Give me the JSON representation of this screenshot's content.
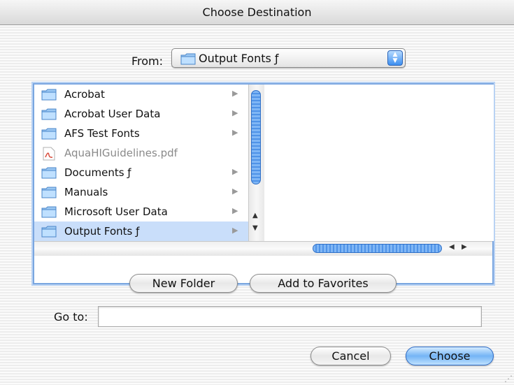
{
  "window": {
    "title": "Choose Destination"
  },
  "from": {
    "label": "From:",
    "selected": "Output Fonts ƒ"
  },
  "browser": {
    "items": [
      {
        "label": "Acrobat",
        "type": "folder"
      },
      {
        "label": "Acrobat User Data",
        "type": "folder"
      },
      {
        "label": "AFS Test Fonts",
        "type": "folder"
      },
      {
        "label": "AquaHIGuidelines.pdf",
        "type": "pdf"
      },
      {
        "label": "Documents ƒ",
        "type": "folder"
      },
      {
        "label": "Manuals",
        "type": "folder"
      },
      {
        "label": "Microsoft User Data",
        "type": "folder"
      },
      {
        "label": "Output Fonts ƒ",
        "type": "folder",
        "selected": true
      }
    ]
  },
  "buttons": {
    "new_folder": "New Folder",
    "add_favorites": "Add to Favorites",
    "cancel": "Cancel",
    "choose": "Choose"
  },
  "goto": {
    "label": "Go to:",
    "value": ""
  },
  "colors": {
    "selection": "#c9defa",
    "accent": "#4f93e8"
  }
}
